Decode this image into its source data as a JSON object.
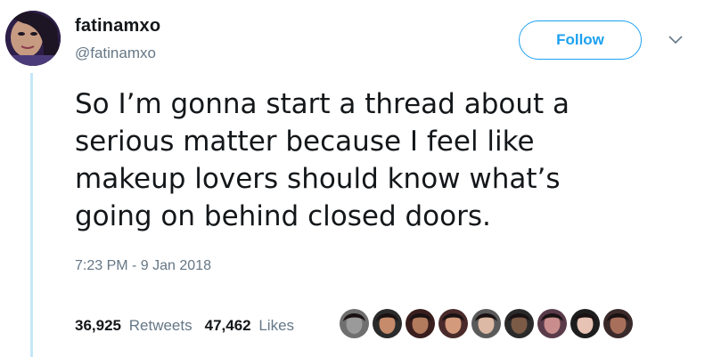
{
  "user": {
    "display_name": "fatinamxo",
    "handle": "@fatinamxo"
  },
  "actions": {
    "follow_label": "Follow"
  },
  "tweet": {
    "lines": [
      "So I’m gonna start a thread about a",
      "serious matter because I feel like",
      "makeup lovers should know what’s",
      "going on behind closed doors."
    ],
    "timestamp": "7:23 PM - 9 Jan 2018"
  },
  "stats": {
    "retweets_count": "36,925",
    "retweets_label": "Retweets",
    "likes_count": "47,462",
    "likes_label": "Likes"
  },
  "colors": {
    "accent": "#1da1f2",
    "text": "#14171a",
    "muted": "#657786",
    "thread_line": "#c4e7f8"
  },
  "icons": {
    "caret": "chevron-down-icon"
  },
  "liker_avatars": [
    {
      "bg": "#6f6f6f",
      "skin": "#9a9a9a"
    },
    {
      "bg": "#2b2b2b",
      "skin": "#c58b6a"
    },
    {
      "bg": "#3a1e1e",
      "skin": "#b27b5e"
    },
    {
      "bg": "#4a2a2a",
      "skin": "#d39a7c"
    },
    {
      "bg": "#5a5a5a",
      "skin": "#dcb9a4"
    },
    {
      "bg": "#2a2a2a",
      "skin": "#7b5a46"
    },
    {
      "bg": "#5a3b4a",
      "skin": "#c98d8d"
    },
    {
      "bg": "#1e1e1e",
      "skin": "#e7c3b5"
    },
    {
      "bg": "#3a2a2a",
      "skin": "#a8705b"
    }
  ]
}
